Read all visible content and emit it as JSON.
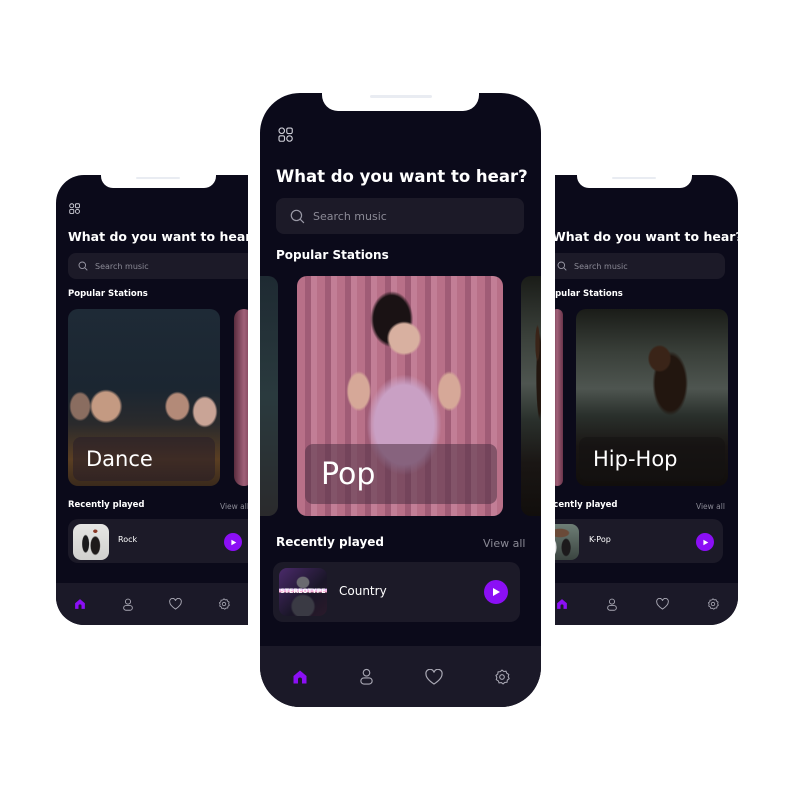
{
  "theme": {
    "background": "#0b0a1a",
    "surface": "#1c1a28",
    "nav_background": "#1b1928",
    "accent": "#8b0ff5",
    "muted_text": "#8a8995"
  },
  "phones": {
    "left": {
      "menu_icon": "apps-grid-icon",
      "title": "What do you want to hear?",
      "search_placeholder": "Search music",
      "popular_heading": "Popular Stations",
      "station_label": "Dance",
      "recent_heading": "Recently played",
      "view_all": "View all",
      "recent_item": "Rock",
      "nav": [
        "home-icon",
        "profile-icon",
        "heart-icon",
        "settings-icon"
      ],
      "active_nav": "home"
    },
    "center": {
      "menu_icon": "apps-grid-icon",
      "title": "What do you want to hear?",
      "search_placeholder": "Search music",
      "popular_heading": "Popular Stations",
      "station_label": "Pop",
      "recent_heading": "Recently played",
      "view_all": "View all",
      "recent_item": "Country",
      "recent_thumb_text": "STEREOTYPE",
      "nav": [
        "home-icon",
        "profile-icon",
        "heart-icon",
        "settings-icon"
      ],
      "active_nav": "home"
    },
    "right": {
      "title": "What do you want to hear?",
      "search_placeholder": "Search music",
      "popular_heading": "Popular Stations",
      "station_label": "Hip-Hop",
      "recent_heading": "Recently played",
      "view_all": "View all",
      "recent_item": "K-Pop",
      "nav": [
        "home-icon",
        "profile-icon",
        "heart-icon",
        "settings-icon"
      ],
      "active_nav": "home"
    }
  }
}
